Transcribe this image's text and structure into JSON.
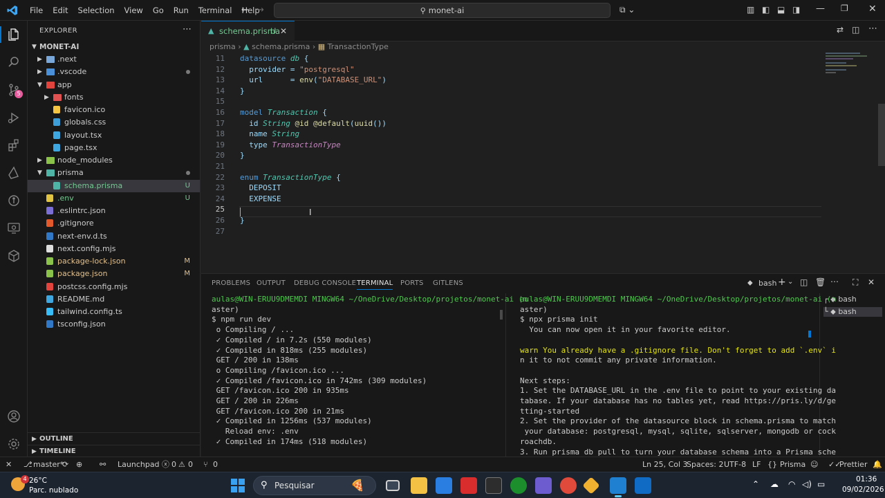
{
  "titlebar": {
    "menus": [
      "File",
      "Edit",
      "Selection",
      "View",
      "Go",
      "Run",
      "Terminal",
      "Help"
    ],
    "command_center": "monet-ai"
  },
  "sidebar": {
    "title": "EXPLORER",
    "root": "MONET-AI",
    "items": [
      {
        "label": ".next",
        "kind": "folder",
        "depth": 1,
        "badge": ""
      },
      {
        "label": ".vscode",
        "kind": "folder",
        "depth": 1,
        "badge": "dot"
      },
      {
        "label": "app",
        "kind": "folder-open",
        "depth": 1,
        "badge": ""
      },
      {
        "label": "fonts",
        "kind": "folder",
        "depth": 2,
        "badge": ""
      },
      {
        "label": "favicon.ico",
        "kind": "file",
        "depth": 2,
        "badge": ""
      },
      {
        "label": "globals.css",
        "kind": "file",
        "depth": 2,
        "badge": ""
      },
      {
        "label": "layout.tsx",
        "kind": "file",
        "depth": 2,
        "badge": ""
      },
      {
        "label": "page.tsx",
        "kind": "file",
        "depth": 2,
        "badge": ""
      },
      {
        "label": "node_modules",
        "kind": "folder",
        "depth": 1,
        "badge": ""
      },
      {
        "label": "prisma",
        "kind": "folder-open",
        "depth": 1,
        "badge": "dot"
      },
      {
        "label": "schema.prisma",
        "kind": "file",
        "depth": 2,
        "badge": "U"
      },
      {
        "label": ".env",
        "kind": "file",
        "depth": 1,
        "badge": "U"
      },
      {
        "label": ".eslintrc.json",
        "kind": "file",
        "depth": 1,
        "badge": ""
      },
      {
        "label": ".gitignore",
        "kind": "file",
        "depth": 1,
        "badge": ""
      },
      {
        "label": "next-env.d.ts",
        "kind": "file",
        "depth": 1,
        "badge": ""
      },
      {
        "label": "next.config.mjs",
        "kind": "file",
        "depth": 1,
        "badge": ""
      },
      {
        "label": "package-lock.json",
        "kind": "file",
        "depth": 1,
        "badge": "M"
      },
      {
        "label": "package.json",
        "kind": "file",
        "depth": 1,
        "badge": "M"
      },
      {
        "label": "postcss.config.mjs",
        "kind": "file",
        "depth": 1,
        "badge": ""
      },
      {
        "label": "README.md",
        "kind": "file",
        "depth": 1,
        "badge": ""
      },
      {
        "label": "tailwind.config.ts",
        "kind": "file",
        "depth": 1,
        "badge": ""
      },
      {
        "label": "tsconfig.json",
        "kind": "file",
        "depth": 1,
        "badge": ""
      }
    ],
    "outline": "OUTLINE",
    "timeline": "TIMELINE"
  },
  "editor": {
    "tab_label": "schema.prisma",
    "tab_badge": "U",
    "breadcrumb": [
      "prisma",
      "schema.prisma",
      "TransactionType"
    ],
    "lines": [
      {
        "n": "11",
        "t": "datasource db {"
      },
      {
        "n": "12",
        "t": "  provider = \"postgresql\""
      },
      {
        "n": "13",
        "t": "  url      = env(\"DATABASE_URL\")"
      },
      {
        "n": "14",
        "t": "}"
      },
      {
        "n": "15",
        "t": ""
      },
      {
        "n": "16",
        "t": "model Transaction {"
      },
      {
        "n": "17",
        "t": "  id String @id @default(uuid())"
      },
      {
        "n": "18",
        "t": "  name String"
      },
      {
        "n": "19",
        "t": "  type TransactionType"
      },
      {
        "n": "20",
        "t": "}"
      },
      {
        "n": "21",
        "t": ""
      },
      {
        "n": "22",
        "t": "enum TransactionType {"
      },
      {
        "n": "23",
        "t": "  DEPOSIT"
      },
      {
        "n": "24",
        "t": "  EXPENSE"
      },
      {
        "n": "25",
        "t": ""
      },
      {
        "n": "26",
        "t": "}"
      },
      {
        "n": "27",
        "t": ""
      }
    ]
  },
  "panel": {
    "tabs": [
      "PROBLEMS",
      "OUTPUT",
      "DEBUG CONSOLE",
      "TERMINAL",
      "PORTS",
      "GITLENS"
    ],
    "active_tab": "TERMINAL",
    "shell_label": "bash",
    "terminal_list": [
      "bash",
      "bash"
    ],
    "left_terminal": [
      "aulas@WIN-ERUU9DMEMDI MINGW64 ~/OneDrive/Desktop/projetos/monet-ai (m",
      "aster)",
      "$ npm run dev",
      " o Compiling / ...",
      " ✓ Compiled / in 7.2s (550 modules)",
      " ✓ Compiled in 818ms (255 modules)",
      " GET / 200 in 138ms",
      " o Compiling /favicon.ico ...",
      " ✓ Compiled /favicon.ico in 742ms (309 modules)",
      " GET /favicon.ico 200 in 935ms",
      " GET / 200 in 226ms",
      " GET /favicon.ico 200 in 21ms",
      " ✓ Compiled in 1256ms (537 modules)",
      "   Reload env: .env",
      " ✓ Compiled in 174ms (518 modules)",
      ""
    ],
    "right_terminal": [
      "aulas@WIN-ERUU9DMEMDI MINGW64 ~/OneDrive/Desktop/projetos/monet-ai (m",
      "aster)",
      "$ npx prisma init",
      "  You can now open it in your favorite editor.",
      "",
      "warn You already have a .gitignore file. Don't forget to add `.env` i",
      "n it to not commit any private information.",
      "",
      "Next steps:",
      "1. Set the DATABASE_URL in the .env file to point to your existing da",
      "tabase. If your database has no tables yet, read https://pris.ly/d/ge",
      "tting-started",
      "2. Set the provider of the datasource block in schema.prisma to match",
      " your database: postgresql, mysql, sqlite, sqlserver, mongodb or cock",
      "roachdb.",
      "3. Run prisma db pull to turn your database schema into a Prisma sche"
    ]
  },
  "statusbar": {
    "branch": "master*",
    "launchpad": "Launchpad",
    "errors": "0",
    "warnings": "0",
    "ports": "0",
    "position": "Ln 25, Col 3",
    "spaces": "Spaces: 2",
    "encoding": "UTF-8",
    "eol": "LF",
    "language": "Prisma",
    "prettier": "Prettier"
  },
  "taskbar": {
    "weather_temp": "26°C",
    "weather_desc": "Parc. nublado",
    "weather_badge": "4",
    "search": "Pesquisar",
    "time": "01:36",
    "date": "09/02/2026"
  }
}
